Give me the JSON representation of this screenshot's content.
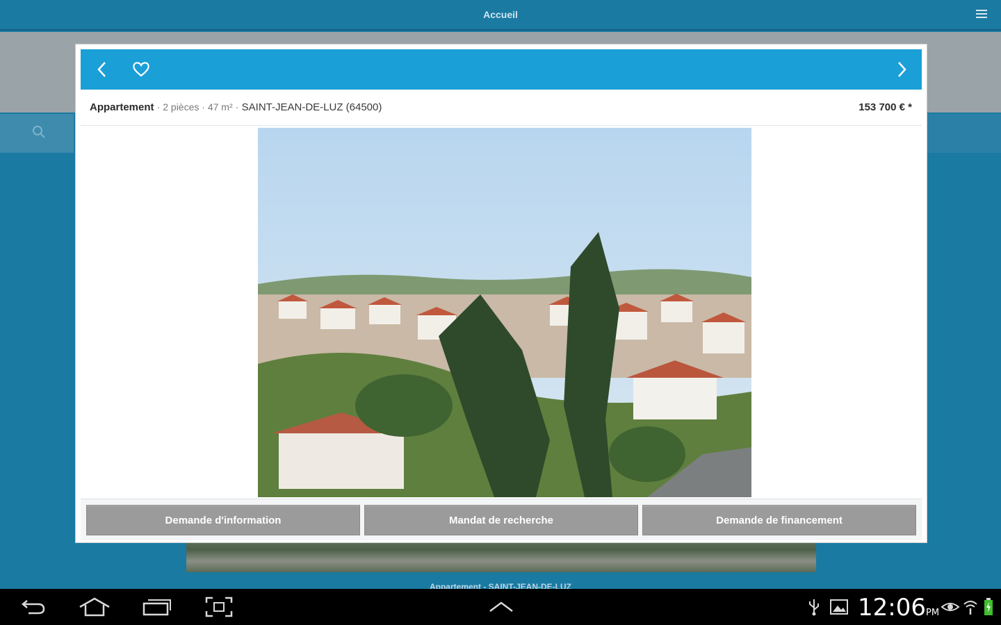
{
  "appbar": {
    "title": "Accueil",
    "menu_icon": "hamburger-menu-icon"
  },
  "background": {
    "caption": "Appartement - SAINT-JEAN-DE-LUZ",
    "search_icon": "search-icon"
  },
  "modal": {
    "header": {
      "prev_icon": "chevron-left-icon",
      "favorite_icon": "heart-outline-icon",
      "next_icon": "chevron-right-icon",
      "color": "#1a9fd6"
    },
    "listing": {
      "type": "Appartement",
      "details": "· 2 pièces · 47 m²",
      "separator": "·",
      "city": "SAINT-JEAN-DE-LUZ (64500)",
      "price": "153 700 € *"
    },
    "actions": {
      "info": "Demande d'information",
      "mandat": "Mandat de recherche",
      "finance": "Demande de financement"
    }
  },
  "system_bar": {
    "time": "12:06",
    "ampm": "PM",
    "icons": [
      "back-icon",
      "home-icon",
      "recent-apps-icon",
      "screenshot-icon",
      "up-chevron-icon",
      "usb-icon",
      "image-notification-icon",
      "eye-icon",
      "wifi-icon",
      "battery-icon"
    ]
  }
}
